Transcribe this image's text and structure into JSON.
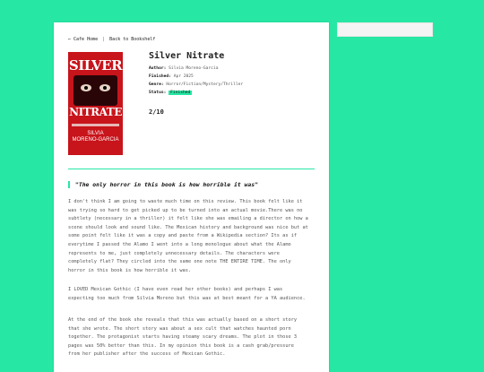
{
  "nav": {
    "cafe_home": "← Cafe Home",
    "separator": "|",
    "back": "Back to Bookshelf"
  },
  "cover": {
    "title_top": "SILVER",
    "title_bottom": "NITRATE",
    "author_line1": "SILVIA",
    "author_line2": "MORENO-GARCIA"
  },
  "book": {
    "title": "Silver Nitrate",
    "author_label": "Author:",
    "author": "Silvia Moreno-Garcia",
    "finished_label": "Finished:",
    "finished": "Apr 2025",
    "genre_label": "Genre:",
    "genre": "Horror/Fiction/Mystery/Thriller",
    "status_label": "Status:",
    "status": "Finished",
    "rating": "2/10"
  },
  "colors": {
    "accent": "#27e7a4",
    "cover": "#c8141b"
  },
  "review": {
    "quote": "\"The only horror in this book is how horrible it was\"",
    "p1": [
      "I don't think I am going to waste much time on this review. This book felt like it",
      "was trying so hard to get picked up to be turned into an actual movie.There was no",
      "subtlety (necessary in a thriller) it felt like she was emailing a director on how a",
      "scene should look and sound like. The Mexican history and background was nice but at",
      "some point felt like it was a copy and paste from a Wikipedia section? Its as if",
      "everytime I passed the Alamo I went into a long monologue about what the Alamo",
      "represents to me, just completely unnecessary details. The characters were",
      "completely flat? They circled into the same one note THE ENTIRE TIME. The only",
      "horror in this book is how horrible it was."
    ],
    "p2": [
      "I LOVED Mexican Gothic (I have even read her other books) and perhaps I was",
      "expecting too much from Silvia Moreno but this was at best meant for a YA audience."
    ],
    "p3": [
      "At the end of the book she reveals that this was actually based on a short story",
      "that she wrote. The short story was about a sex cult that watches haunted porn",
      "together. The protagonist starts having steamy scary dreams. The plot in those 3",
      "pages was 50% better than this. In my opinion this book is a cash grab/pressure",
      "from her publisher after the success of Mexican Gothic."
    ]
  }
}
